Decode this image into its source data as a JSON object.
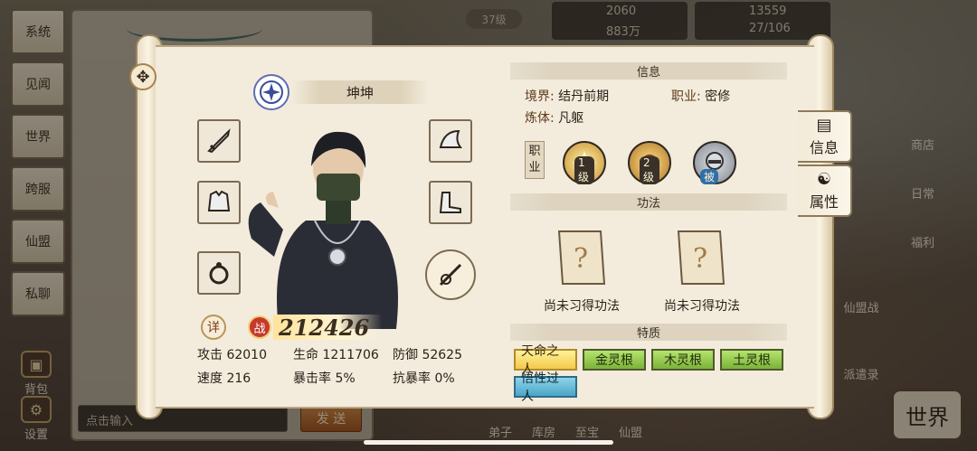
{
  "side_menu": [
    "系统",
    "见闻",
    "世界",
    "跨服",
    "仙盟",
    "私聊"
  ],
  "side_bottom": [
    {
      "label": "背包",
      "icon": "bag-icon"
    },
    {
      "label": "设置",
      "icon": "gear-icon"
    }
  ],
  "chat": {
    "input_placeholder": "点击输入",
    "send_label": "发 送"
  },
  "top_bar": {
    "level": "37级",
    "res1": {
      "a": "2060",
      "b": "883万"
    },
    "res2": {
      "a": "13559",
      "b": "27/106"
    }
  },
  "right_world_menu": [
    "商店",
    "日常",
    "福利",
    "仙盟战",
    "派遣录"
  ],
  "bottom_nav": [
    "弟子",
    "库房",
    "至宝",
    "仙盟"
  ],
  "world_badge": "世界",
  "character": {
    "name": "坤坤",
    "detail_label": "详",
    "power_label": "战",
    "power_value": "212426",
    "stats": [
      [
        {
          "k": "攻击",
          "v": "62010"
        },
        {
          "k": "生命",
          "v": "1211706"
        },
        {
          "k": "防御",
          "v": "52625"
        }
      ],
      [
        {
          "k": "速度",
          "v": "216"
        },
        {
          "k": "暴击率",
          "v": "5%"
        },
        {
          "k": "抗暴率",
          "v": "0%"
        }
      ]
    ],
    "equip_slots": [
      "sword-icon",
      "armor-icon",
      "ring-icon",
      "helmet-icon",
      "boots-icon",
      "weapon-talisman-icon"
    ]
  },
  "info": {
    "title": "信息",
    "realm_key": "境界:",
    "realm_val": "结丹前期",
    "job_key": "职业:",
    "job_val": "密修",
    "body_key": "炼体:",
    "body_val": "凡躯",
    "job_label": "职业",
    "skills": [
      {
        "tag": "1级",
        "icon": "burst-skill-icon",
        "color": "#f0c84a"
      },
      {
        "tag": "2级",
        "icon": "sun-skill-icon",
        "color": "#e8b64a"
      },
      {
        "tag": "被",
        "icon": "masked-passive-icon",
        "color": "#9aa0a8"
      }
    ]
  },
  "technique": {
    "title": "功法",
    "slots": [
      "尚未习得功法",
      "尚未习得功法"
    ]
  },
  "traits": {
    "title": "特质",
    "items": [
      {
        "label": "天命之人",
        "style": "gold"
      },
      {
        "label": "金灵根",
        "style": "green"
      },
      {
        "label": "木灵根",
        "style": "green"
      },
      {
        "label": "土灵根",
        "style": "green"
      },
      {
        "label": "悟性过人",
        "style": "blue"
      }
    ]
  },
  "tabs": [
    {
      "label": "信息",
      "icon": "info-book-icon"
    },
    {
      "label": "属性",
      "icon": "attribute-figure-icon"
    }
  ]
}
